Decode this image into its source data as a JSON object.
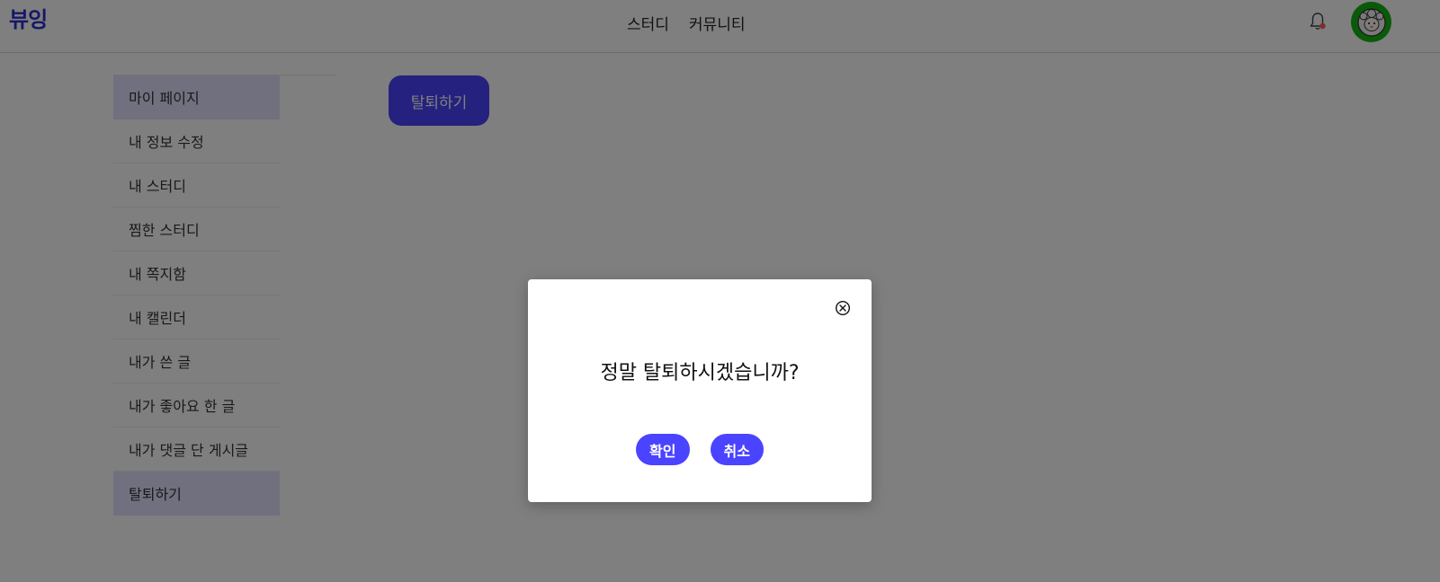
{
  "header": {
    "logo": "뷰잉",
    "nav": [
      "스터디",
      "커뮤니티"
    ],
    "icons": {
      "notification": "bell-icon",
      "avatar": "sheep-avatar"
    },
    "colors": {
      "brand": "#2f2fd0",
      "avatar_bg": "#14b514",
      "notification_dot": "#ff5a5a"
    }
  },
  "sidebar": {
    "items": [
      {
        "label": "마이 페이지",
        "active": true
      },
      {
        "label": "내 정보 수정",
        "active": false
      },
      {
        "label": "내 스터디",
        "active": false
      },
      {
        "label": "찜한 스터디",
        "active": false
      },
      {
        "label": "내 쪽지함",
        "active": false
      },
      {
        "label": "내 캘린더",
        "active": false
      },
      {
        "label": "내가 쓴 글",
        "active": false
      },
      {
        "label": "내가 좋아요 한 글",
        "active": false
      },
      {
        "label": "내가 댓글 단 게시글",
        "active": false
      },
      {
        "label": "탈퇴하기",
        "active": true
      }
    ],
    "colors": {
      "active_bg": "#e3e0ff"
    }
  },
  "main": {
    "withdraw_button": "탈퇴하기",
    "colors": {
      "accent": "#4a43ff"
    }
  },
  "modal": {
    "message": "정말 탈퇴하시겠습니까?",
    "confirm_label": "확인",
    "cancel_label": "취소",
    "close_icon": "close-circle-icon"
  }
}
